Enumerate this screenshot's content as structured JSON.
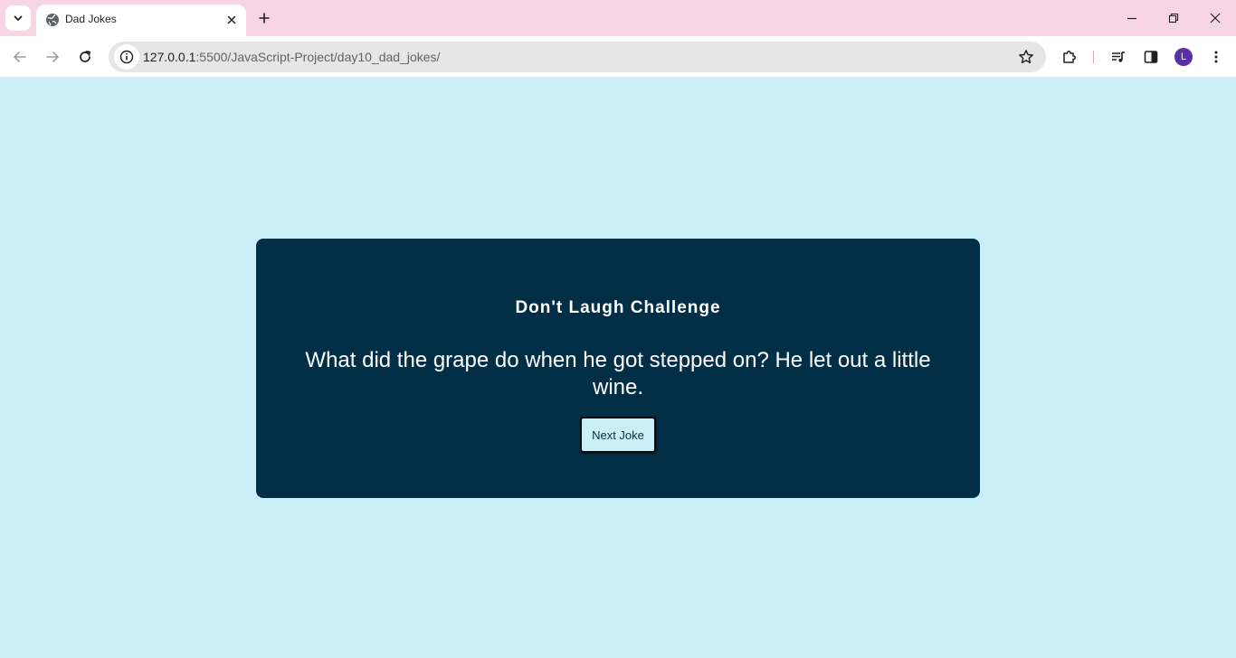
{
  "browser": {
    "tab": {
      "title": "Dad Jokes"
    },
    "url": {
      "host": "127.0.0.1",
      "rest": ":5500/JavaScript-Project/day10_dad_jokes/"
    },
    "profile_initial": "L",
    "accent_color": "#5b2fa8",
    "tabstrip_color": "#f7d5e4"
  },
  "page": {
    "background_color": "#caeff7",
    "card_color": "#022f46",
    "title": "Don't Laugh Challenge",
    "joke": "What did the grape do when he got stepped on? He let out a little wine.",
    "button_label": "Next Joke"
  }
}
